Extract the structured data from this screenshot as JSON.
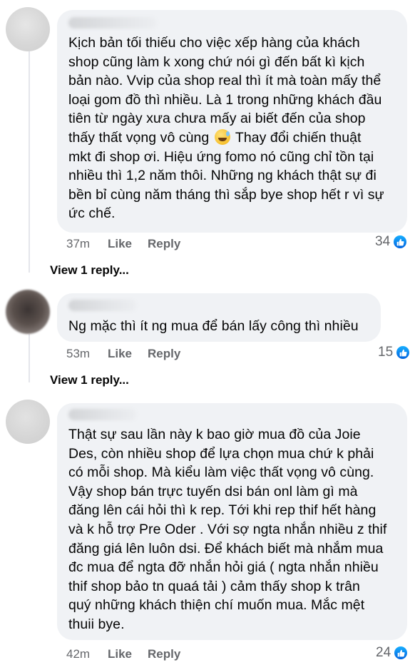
{
  "comments": [
    {
      "text": "Kịch bản tối thiếu cho việc xếp hàng của khách\nshop cũng làm k xong chứ nói gì đến bất kì kịch\nbản nào. Vvip của shop real thì ít mà toàn mấy thể\nloại gom đồ thì nhiều. Là 1 trong những khách đầu\ntiên từ ngày xưa chưa mấy ai biết đến của shop\nthấy thất vọng vô cùng",
      "text_after_emoji": " Thay đổi chiến thuật\nmkt đi shop ơi. Hiệu ứng fomo nó cũng chỉ tồn tại\nnhiều thì 1,2 năm thôi. Những ng khách thật sự đi\nbền bỉ cùng năm tháng thì sắp bye shop hết r vì sự\nức chế.",
      "emoji": "grinning-sweat-emoji",
      "time": "37m",
      "like_label": "Like",
      "reply_label": "Reply",
      "reaction_count": "34",
      "view_replies": "View 1 reply..."
    },
    {
      "text": "Ng mặc thì ít ng mua để bán lấy công thì nhiều",
      "time": "53m",
      "like_label": "Like",
      "reply_label": "Reply",
      "reaction_count": "15",
      "view_replies": "View 1 reply..."
    },
    {
      "text": "Thật sự sau lần này k bao giờ mua đồ của Joie\nDes, còn nhiều shop để lựa chọn mua chứ k phải\ncó mỗi shop. Mà kiểu làm việc thất vọng vô cùng.\nVậy shop bán trực tuyến dsi bán onl làm gì mà\nđăng lên cái hỏi thì k rep. Tới khi rep thif hết hàng\nvà k hỗ trợ Pre Oder . Với sợ ngta nhắn nhiều z thif\nđăng giá lên luôn dsi. Để khách biết mà nhắm mua\nđc mua để ngta đỡ nhắn hỏi giá ( ngta nhắn nhiều\nthif shop bảo tn quaá tải ) cảm thấy shop k trân\nquý những khách thiện chí muốn mua. Mắc mệt\nthuii bye.",
      "time": "42m",
      "like_label": "Like",
      "reply_label": "Reply",
      "reaction_count": "24"
    }
  ],
  "colors": {
    "bubble": "#f0f2f5",
    "meta_text": "#65676b",
    "like_badge": "#1877f2"
  },
  "icons": [
    "like-reaction-icon"
  ]
}
